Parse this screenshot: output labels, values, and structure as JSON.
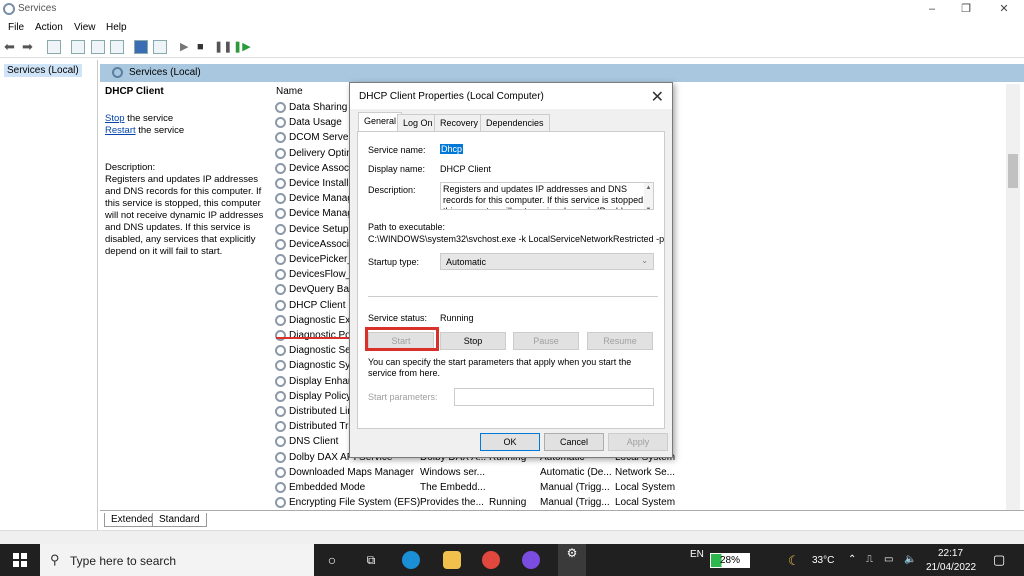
{
  "window": {
    "title": "Services"
  },
  "menu": [
    "File",
    "Action",
    "View",
    "Help"
  ],
  "tree": {
    "root": "Services (Local)"
  },
  "header": {
    "title": "Services (Local)"
  },
  "desc": {
    "service_name": "DHCP Client",
    "stop_link": "Stop",
    "stop_rest": " the service",
    "restart_link": "Restart",
    "restart_rest": " the service",
    "label": "Description:",
    "text": "Registers and updates IP addresses and DNS records for this computer. If this service is stopped, this computer will not receive dynamic IP addresses and DNS updates. If this service is disabled, any services that explicitly depend on it will fail to start."
  },
  "list": {
    "col_name": "Name",
    "rows": [
      {
        "name": "Data Sharing S",
        "desc": "",
        "status": "",
        "startup": "",
        "logon": ""
      },
      {
        "name": "Data Usage",
        "desc": "",
        "status": "",
        "startup": "",
        "logon": ""
      },
      {
        "name": "DCOM Server P",
        "desc": "",
        "status": "",
        "startup": "",
        "logon": ""
      },
      {
        "name": "Delivery Optim",
        "desc": "",
        "status": "",
        "startup": "",
        "logon": ""
      },
      {
        "name": "Device Associat",
        "desc": "",
        "status": "",
        "startup": "",
        "logon": ""
      },
      {
        "name": "Device Install S",
        "desc": "",
        "status": "",
        "startup": "",
        "logon": ""
      },
      {
        "name": "Device Manage",
        "desc": "",
        "status": "",
        "startup": "",
        "logon": ""
      },
      {
        "name": "Device Manage",
        "desc": "",
        "status": "",
        "startup": "",
        "logon": ""
      },
      {
        "name": "Device Setup M",
        "desc": "",
        "status": "",
        "startup": "",
        "logon": ""
      },
      {
        "name": "DeviceAssociat",
        "desc": "",
        "status": "",
        "startup": "",
        "logon": ""
      },
      {
        "name": "DevicePicker_d",
        "desc": "",
        "status": "",
        "startup": "",
        "logon": ""
      },
      {
        "name": "DevicesFlow_di",
        "desc": "",
        "status": "",
        "startup": "",
        "logon": ""
      },
      {
        "name": "DevQuery Back",
        "desc": "",
        "status": "",
        "startup": "",
        "logon": ""
      },
      {
        "name": "DHCP Client",
        "desc": "",
        "status": "",
        "startup": "",
        "logon": ""
      },
      {
        "name": "Diagnostic Exe",
        "desc": "",
        "status": "",
        "startup": "",
        "logon": ""
      },
      {
        "name": "Diagnostic Pol",
        "desc": "",
        "status": "",
        "startup": "",
        "logon": ""
      },
      {
        "name": "Diagnostic Ser",
        "desc": "",
        "status": "",
        "startup": "",
        "logon": ""
      },
      {
        "name": "Diagnostic Sys",
        "desc": "",
        "status": "",
        "startup": "",
        "logon": ""
      },
      {
        "name": "Display Enhan",
        "desc": "",
        "status": "",
        "startup": "",
        "logon": ""
      },
      {
        "name": "Display Policy S",
        "desc": "",
        "status": "",
        "startup": "",
        "logon": ""
      },
      {
        "name": "Distributed Lin",
        "desc": "",
        "status": "",
        "startup": "",
        "logon": ""
      },
      {
        "name": "Distributed Tra",
        "desc": "",
        "status": "",
        "startup": "",
        "logon": ""
      },
      {
        "name": "DNS Client",
        "desc": "",
        "status": "",
        "startup": "",
        "logon": ""
      },
      {
        "name": "Dolby DAX API Service",
        "desc": "Dolby DAX A...",
        "status": "Running",
        "startup": "Automatic",
        "logon": "Local System"
      },
      {
        "name": "Downloaded Maps Manager",
        "desc": "Windows ser...",
        "status": "",
        "startup": "Automatic (De...",
        "logon": "Network Se..."
      },
      {
        "name": "Embedded Mode",
        "desc": "The Embedd...",
        "status": "",
        "startup": "Manual (Trigg...",
        "logon": "Local System"
      },
      {
        "name": "Encrypting File System (EFS)",
        "desc": "Provides the...",
        "status": "Running",
        "startup": "Manual (Trigg...",
        "logon": "Local System"
      }
    ]
  },
  "bottom_tabs": [
    "Extended",
    "Standard"
  ],
  "dialog": {
    "title": "DHCP Client Properties (Local Computer)",
    "tabs": [
      "General",
      "Log On",
      "Recovery",
      "Dependencies"
    ],
    "service_name_label": "Service name:",
    "service_name": "Dhcp",
    "display_name_label": "Display name:",
    "display_name": "DHCP Client",
    "description_label": "Description:",
    "description": "Registers and updates IP addresses and DNS records for this computer. If this service is stopped, this computer will not receive dynamic IP addresses",
    "path_label": "Path to executable:",
    "path": "C:\\WINDOWS\\system32\\svchost.exe -k LocalServiceNetworkRestricted -p",
    "startup_label": "Startup type:",
    "startup_value": "Automatic",
    "status_label": "Service status:",
    "status_value": "Running",
    "btn_start": "Start",
    "btn_stop": "Stop",
    "btn_pause": "Pause",
    "btn_resume": "Resume",
    "hint": "You can specify the start parameters that apply when you start the service from here.",
    "params_label": "Start parameters:",
    "ok": "OK",
    "cancel": "Cancel",
    "apply": "Apply"
  },
  "taskbar": {
    "search_placeholder": "Type here to search",
    "lang": "EN",
    "battery": "28%",
    "battery_level": 0.28,
    "weather": "33°C",
    "time": "22:17",
    "date": "21/04/2022"
  },
  "colors": {
    "highlight": "#d9302a",
    "header": "#a9c8df",
    "accent": "#0078d7"
  }
}
